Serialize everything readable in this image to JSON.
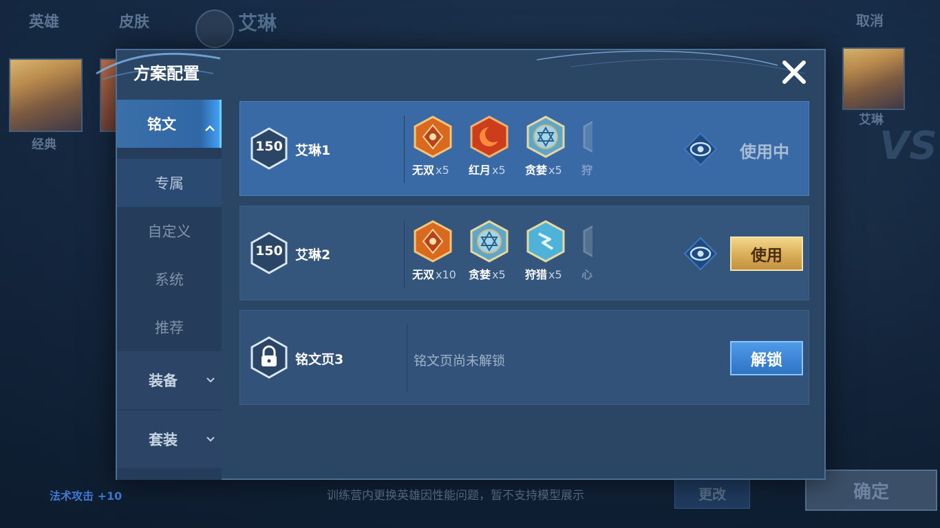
{
  "background": {
    "tabs": {
      "hero": "英雄",
      "skin": "皮肤"
    },
    "hero_name": "艾琳",
    "cancel_label": "取消",
    "left_portrait_label": "经典",
    "right_portrait_label": "艾琳",
    "stat_label": "法术攻击",
    "stat_value": "+10",
    "notice": "训练营内更换英雄因性能问题，暂不支持模型展示",
    "change_label": "更改",
    "confirm_label": "确定"
  },
  "modal": {
    "title": "方案配置",
    "sidebar": {
      "items": [
        {
          "label": "铭文"
        },
        {
          "label": "专属"
        },
        {
          "label": "自定义"
        },
        {
          "label": "系统"
        },
        {
          "label": "推荐"
        },
        {
          "label": "装备"
        },
        {
          "label": "套装"
        }
      ]
    },
    "rows": [
      {
        "level": "150",
        "name": "艾琳1",
        "runes": [
          {
            "name": "无双",
            "count": "x5",
            "icon": "wushuang-rune-icon"
          },
          {
            "name": "红月",
            "count": "x5",
            "icon": "hongyue-rune-icon"
          },
          {
            "name": "贪婪",
            "count": "x5",
            "icon": "tanlan-rune-icon"
          },
          {
            "name": "狩",
            "count": "",
            "icon": "partial-rune-icon"
          }
        ],
        "status": "使用中"
      },
      {
        "level": "150",
        "name": "艾琳2",
        "runes": [
          {
            "name": "无双",
            "count": "x10",
            "icon": "wushuang-rune-icon"
          },
          {
            "name": "贪婪",
            "count": "x5",
            "icon": "tanlan-rune-icon"
          },
          {
            "name": "狩猎",
            "count": "x5",
            "icon": "shoulie-rune-icon"
          },
          {
            "name": "心",
            "count": "",
            "icon": "partial-rune-icon"
          }
        ],
        "button": "使用"
      },
      {
        "name": "铭文页3",
        "message": "铭文页尚未解锁",
        "button": "解锁"
      }
    ]
  },
  "colors": {
    "accent_blue": "#3a6aa6",
    "gold_button": "#d9ad57",
    "unlock_button": "#2f73c4"
  }
}
